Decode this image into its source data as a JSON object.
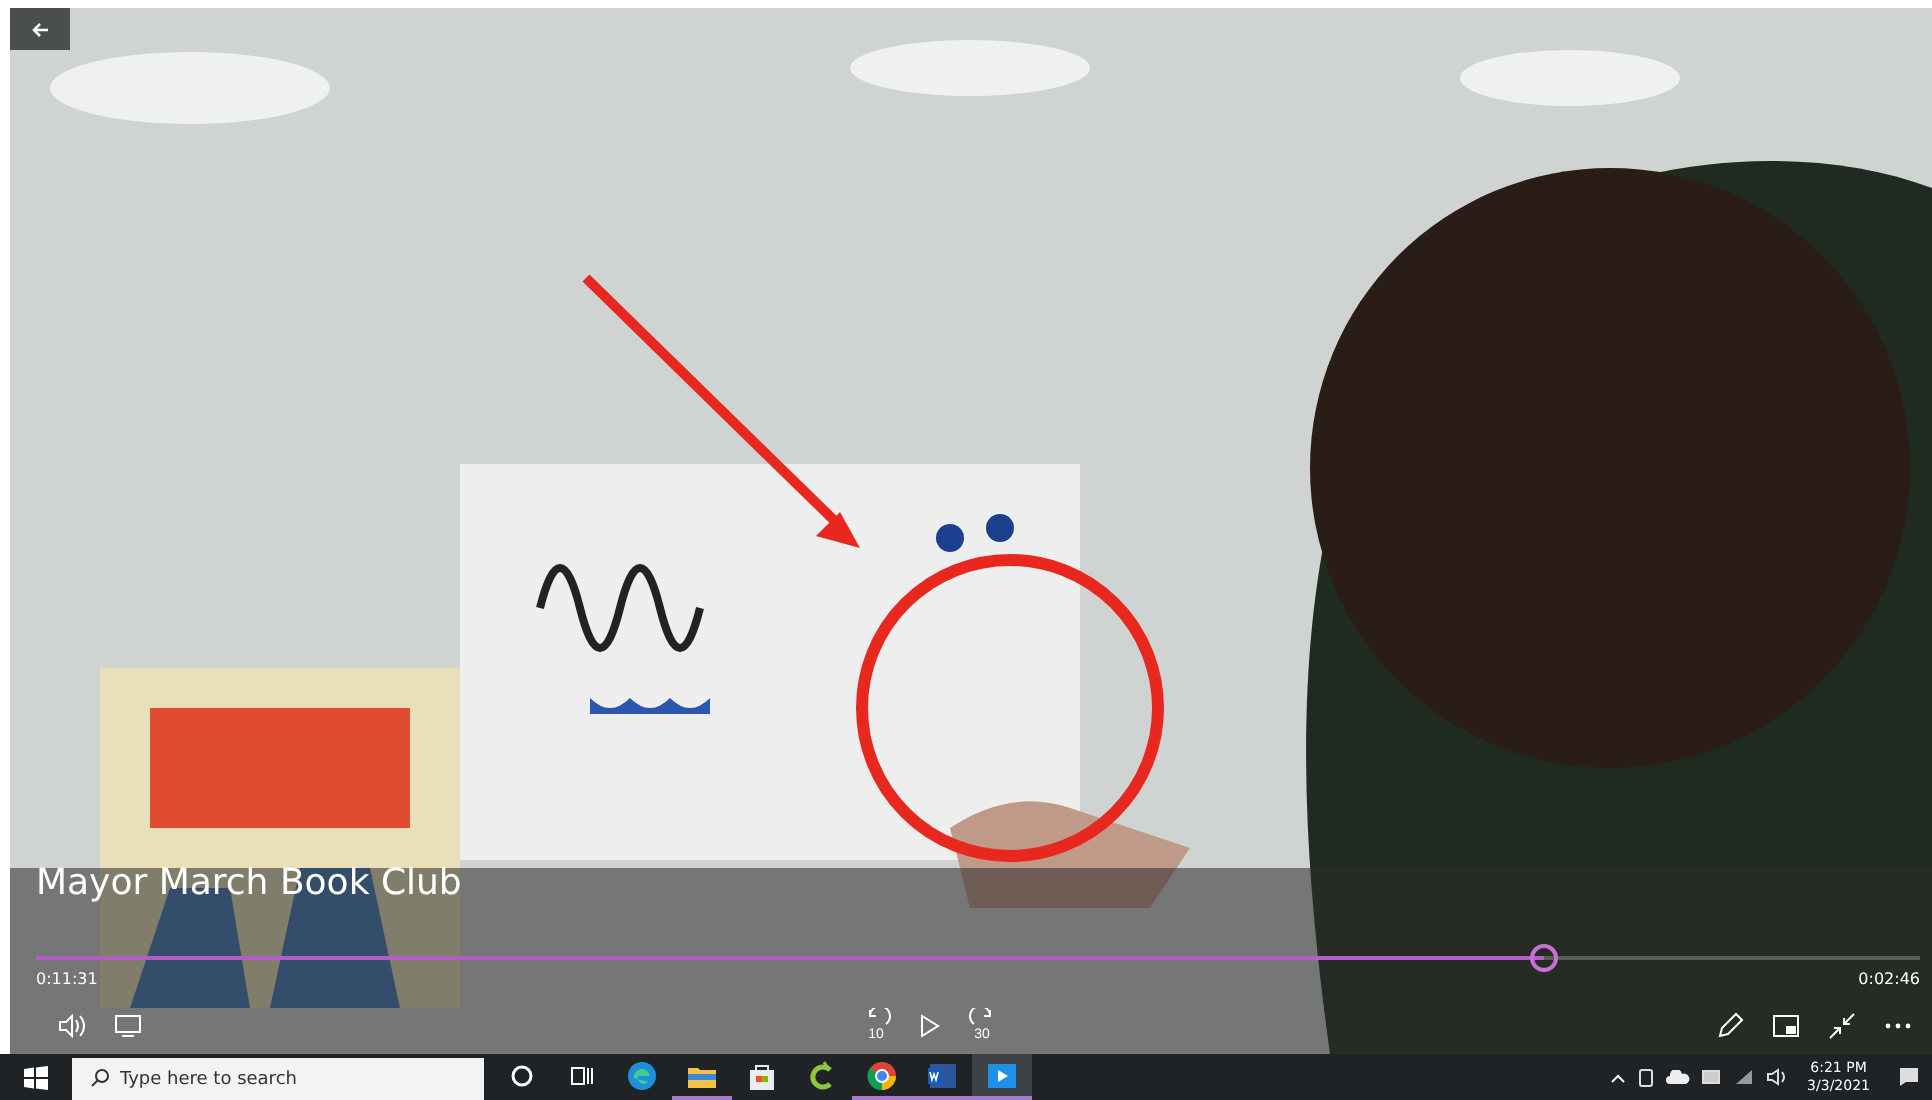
{
  "player": {
    "title": "Mayor March Book Club",
    "elapsed": "0:11:31",
    "remaining": "0:02:46",
    "seek": {
      "level": 0.8
    },
    "controls": [
      {
        "kind": "back10",
        "label": "10"
      },
      {
        "kind": "play"
      },
      {
        "kind": "fwd30",
        "label": "30"
      }
    ]
  },
  "taskbar": {
    "search": {
      "placeholder": "Type here to search"
    },
    "apps": [
      {
        "kind": "cortana",
        "running": false,
        "selected": false
      },
      {
        "kind": "taskview",
        "running": false,
        "selected": false
      },
      {
        "kind": "edge",
        "running": false,
        "selected": false
      },
      {
        "kind": "explorer",
        "running": true,
        "selected": false
      },
      {
        "kind": "store",
        "running": false,
        "selected": false
      },
      {
        "kind": "greenapp",
        "running": false,
        "selected": false
      },
      {
        "kind": "chrome",
        "running": true,
        "selected": false
      },
      {
        "kind": "word",
        "running": true,
        "selected": false
      },
      {
        "kind": "movies",
        "running": true,
        "selected": true
      }
    ],
    "clock": {
      "time": "6:21 PM",
      "date": "3/3/2021"
    }
  }
}
